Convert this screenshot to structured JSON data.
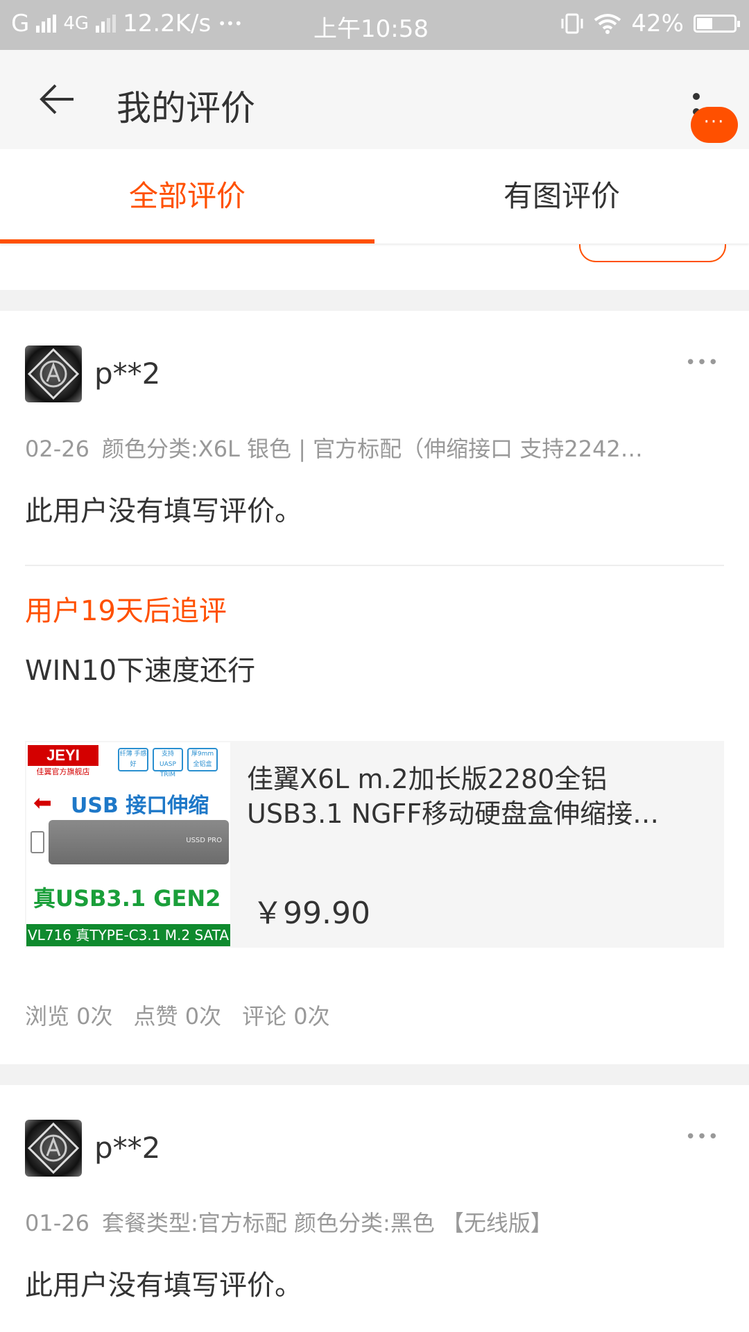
{
  "status_bar": {
    "left": "G",
    "network": "4G",
    "speed": "12.2K/s",
    "dots": "•••",
    "time": "上午10:58",
    "battery": "42%",
    "battery_level": 0.42
  },
  "header": {
    "title": "我的评价",
    "badge": "···"
  },
  "tabs": [
    {
      "label": "全部评价",
      "active": true
    },
    {
      "label": "有图评价",
      "active": false
    }
  ],
  "reviews": [
    {
      "username": "p**2",
      "more": "•••",
      "date": "02-26",
      "spec": "颜色分类:X6L 银色 | 官方标配（伸缩接口 支持2242…",
      "text": "此用户没有填写评价。",
      "append_label": "用户19天后追评",
      "append_text": "WIN10下速度还行",
      "product": {
        "title": "佳翼X6L m.2加长版2280全铝USB3.1 NGFF移动硬盘盒伸缩接…",
        "price": "￥99.90",
        "image_text": {
          "brand": "JEYI",
          "shop": "佳翼官方旗舰店",
          "tag1": "纤薄 手感好",
          "tag2": "支持 UASP TRIM",
          "tag3": "厚9mm 全铝盒",
          "headline": "USB 接口伸缩",
          "device": "USSD PRO",
          "gen": "真USB3.1 GEN2",
          "bar": "VL716 真TYPE-C3.1 M.2 SATA"
        }
      },
      "stats": {
        "views": "浏览 0次",
        "likes": "点赞 0次",
        "comments": "评论 0次"
      }
    },
    {
      "username": "p**2",
      "more": "•••",
      "date": "01-26",
      "spec": "套餐类型:官方标配 颜色分类:黑色 【无线版】",
      "text": "此用户没有填写评价。"
    }
  ],
  "colors": {
    "accent": "#ff5000",
    "status_bar": "#c4c4c4",
    "separator": "#f2f2f2"
  }
}
